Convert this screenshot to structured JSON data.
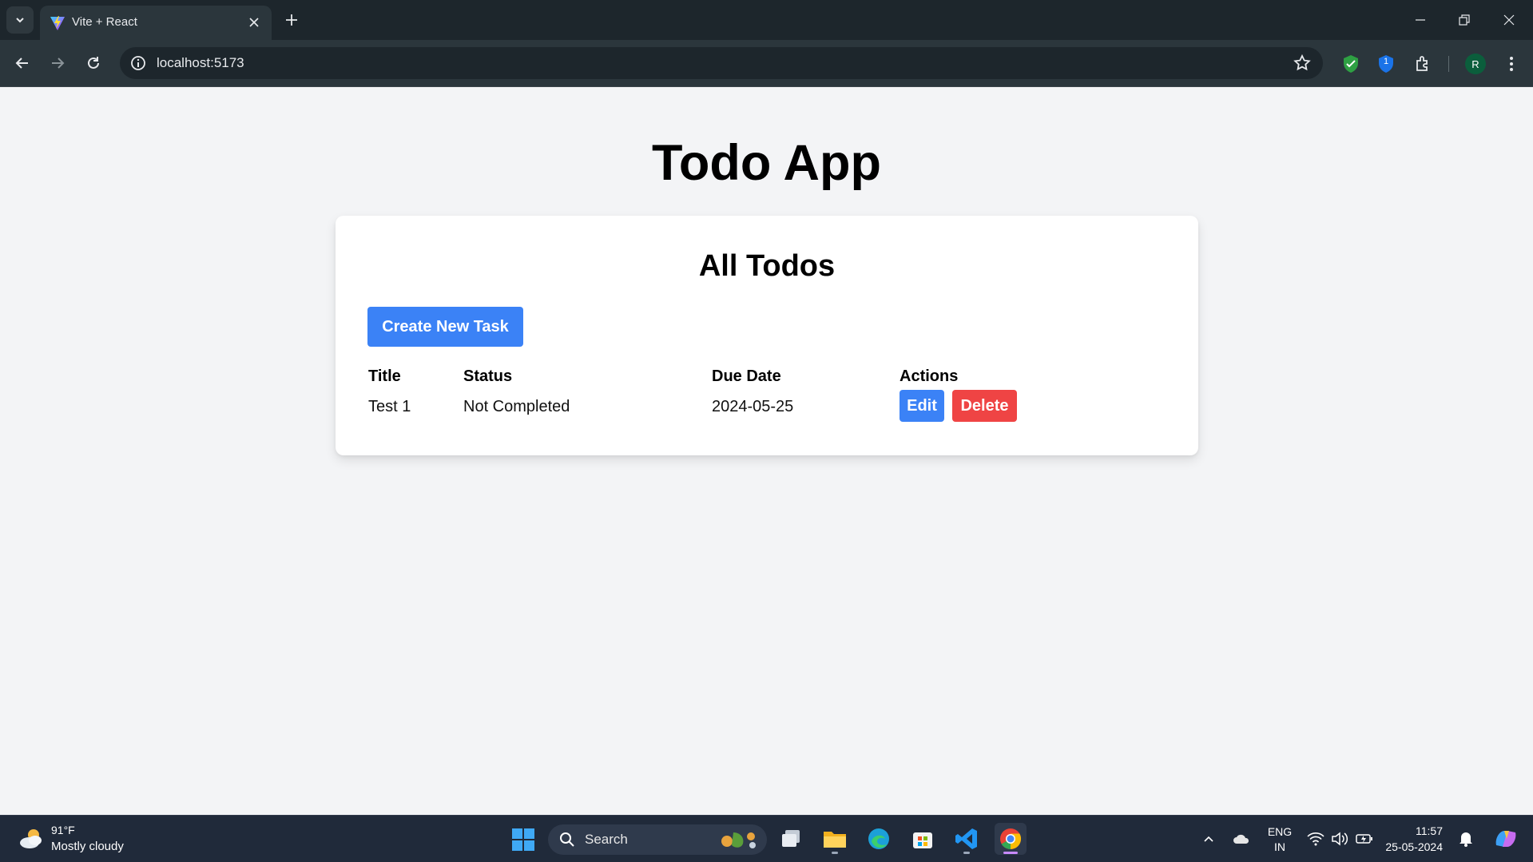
{
  "browser": {
    "tab_title": "Vite + React",
    "url": "localhost:5173",
    "profile_initial": "R",
    "extension_badge": "1"
  },
  "app": {
    "title": "Todo App",
    "card_title": "All Todos",
    "create_label": "Create New Task",
    "columns": [
      "Title",
      "Status",
      "Due Date",
      "Actions"
    ],
    "todos": [
      {
        "title": "Test 1",
        "status": "Not Completed",
        "due_date": "2024-05-25",
        "edit_label": "Edit",
        "delete_label": "Delete"
      }
    ]
  },
  "colors": {
    "primary": "#3b82f6",
    "danger": "#ef4444",
    "page_bg": "#f3f4f6"
  },
  "taskbar": {
    "weather_temp": "91°F",
    "weather_desc": "Mostly cloudy",
    "search_label": "Search",
    "lang_line1": "ENG",
    "lang_line2": "IN",
    "time": "11:57",
    "date": "25-05-2024"
  }
}
